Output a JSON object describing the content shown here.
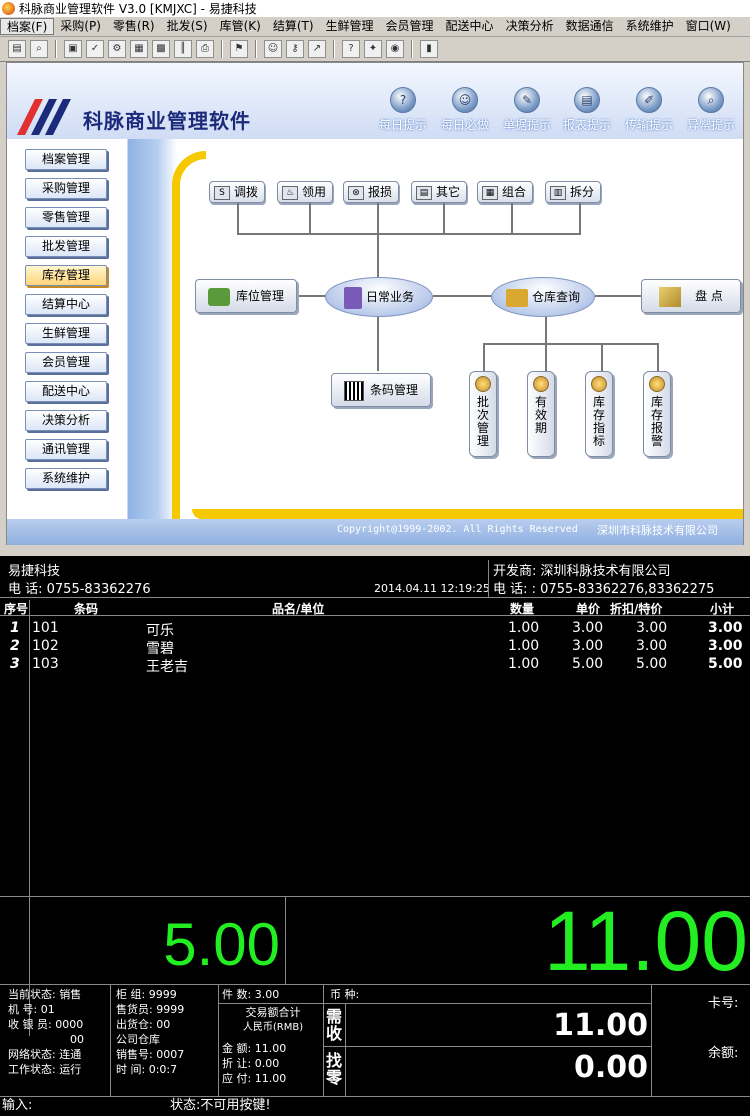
{
  "window": {
    "title": "科脉商业管理软件 V3.0 [KMJXC] - 易捷科技"
  },
  "menu": [
    "档案(F)",
    "采购(P)",
    "零售(R)",
    "批发(S)",
    "库管(K)",
    "结算(T)",
    "生鲜管理",
    "会员管理",
    "配送中心",
    "决策分析",
    "数据通信",
    "系统维护",
    "窗口(W)"
  ],
  "banner": {
    "brand": "科脉商业管理软件",
    "tips": [
      "每日提示",
      "每日必做",
      "单据提示",
      "报表提示",
      "传输提示",
      "异常提示"
    ]
  },
  "nav": [
    "档案管理",
    "采购管理",
    "零售管理",
    "批发管理",
    "库存管理",
    "结算中心",
    "生鲜管理",
    "会员管理",
    "配送中心",
    "决策分析",
    "通讯管理",
    "系统维护"
  ],
  "flow": {
    "top": [
      "调拨",
      "领用",
      "报损",
      "其它",
      "组合",
      "拆分"
    ],
    "location": "库位管理",
    "daily": "日常业务",
    "query": "仓库查询",
    "inventory": "盘  点",
    "barcode": "条码管理",
    "sub": [
      "批次管理",
      "有效期",
      "库存指标",
      "库存报警"
    ]
  },
  "footer": {
    "copyright": "Copyright@1999-2002. All Rights Reserved",
    "company": "深圳市科脉技术有限公司"
  },
  "pos": {
    "store": "易捷科技",
    "phone": "电  话: 0755-83362276",
    "datetime": "2014.04.11 12:19:25",
    "developer": "开发商: 深圳科脉技术有限公司",
    "dev_phone": "电  话: : 0755-83362276,83362275",
    "columns": {
      "idx": "序号",
      "code": "条码",
      "name": "品名/单位",
      "qty": "数量",
      "price": "单价",
      "disc": "折扣/特价",
      "sub": "小计"
    },
    "items": [
      {
        "idx": "1",
        "code": "101",
        "name": "可乐",
        "qty": "1.00",
        "price": "3.00",
        "disc": "3.00",
        "sub": "3.00"
      },
      {
        "idx": "2",
        "code": "102",
        "name": "雪碧",
        "qty": "1.00",
        "price": "3.00",
        "disc": "3.00",
        "sub": "3.00"
      },
      {
        "idx": "3",
        "code": "103",
        "name": "王老吉",
        "qty": "1.00",
        "price": "5.00",
        "disc": "5.00",
        "sub": "5.00"
      }
    ],
    "big_qty": "5.00",
    "big_total": "11.00",
    "status": {
      "s1": [
        "当前状态:",
        "销售"
      ],
      "s2": [
        "机    号:",
        "01"
      ],
      "s3": [
        "收 银 员:",
        "0000"
      ],
      "s3b": "00",
      "s4": [
        "网络状态:",
        "连通"
      ],
      "s5": [
        "工作状态:",
        "运行"
      ],
      "c1": [
        "柜  组:",
        "9999"
      ],
      "c2": [
        "售货员:",
        "9999"
      ],
      "c3": [
        "出货仓:",
        "00"
      ],
      "c3b": "公司仓库",
      "c4": [
        "销售号:",
        "0007"
      ],
      "c5": [
        "时  间:",
        "0:0:7"
      ],
      "pieces": "件  数: 3.00",
      "trade_label": "交易额合计",
      "currency_rmb": "人民币(RMB)",
      "amount": "金  额: 11.00",
      "discount": "折  让: 0.00",
      "payable": "应  付: 11.00",
      "coin": "币  种:",
      "need_recv": "需收",
      "change_label": "找零",
      "recv_amount": "11.00",
      "change_amount": "0.00",
      "card": "卡号:",
      "balance": "余额:"
    },
    "input_label": "输入:",
    "state_msg": "状态:不可用按键!"
  }
}
